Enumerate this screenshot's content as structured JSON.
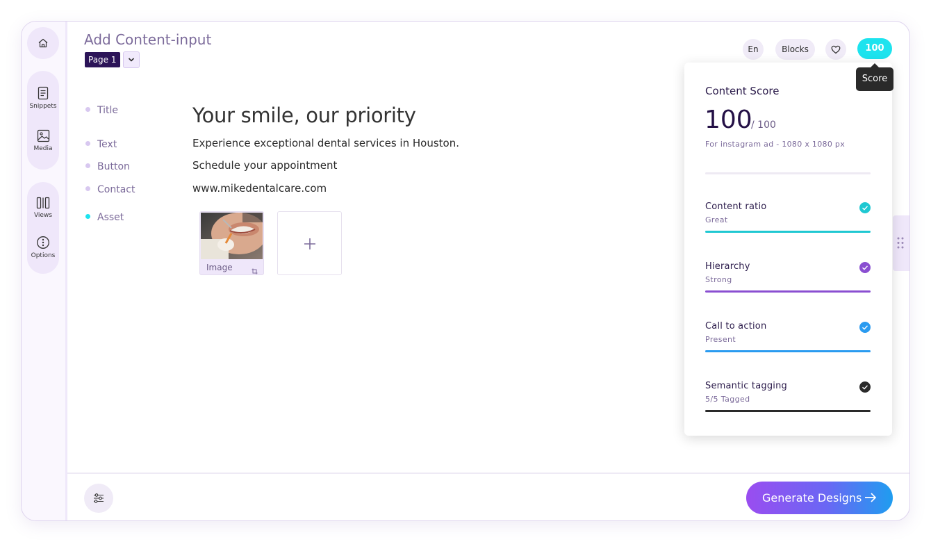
{
  "header": {
    "title": "Add Content-input",
    "page_chip": "Page 1"
  },
  "sidebar": {
    "items": [
      {
        "icon": "home-icon",
        "label": ""
      },
      {
        "icon": "document-icon",
        "label": "Snippets"
      },
      {
        "icon": "image-icon",
        "label": "Media"
      },
      {
        "icon": "columns-icon",
        "label": "Views"
      },
      {
        "icon": "options-icon",
        "label": "Options"
      }
    ]
  },
  "toolbar": {
    "language": "En",
    "blocks": "Blocks",
    "score": "100",
    "score_tooltip": "Score"
  },
  "fields": [
    {
      "label": "Title",
      "value": "Your smile, our priority"
    },
    {
      "label": "Text",
      "value": "Experience exceptional dental services in Houston."
    },
    {
      "label": "Button",
      "value": "Schedule your appointment"
    },
    {
      "label": "Contact",
      "value": "www.mikedentalcare.com"
    },
    {
      "label": "Asset",
      "value": ""
    }
  ],
  "asset": {
    "caption": "Image"
  },
  "score_panel": {
    "heading": "Content Score",
    "value": "100",
    "max": "/ 100",
    "note": "For instagram ad - 1080 x 1080 px",
    "metrics": [
      {
        "name": "Content ratio",
        "status": "Great",
        "color": "#1fc8d2"
      },
      {
        "name": "Hierarchy",
        "status": "Strong",
        "color": "#8a4fd1"
      },
      {
        "name": "Call to action",
        "status": "Present",
        "color": "#2a9bf0"
      },
      {
        "name": "Semantic tagging",
        "status": "5/5 Tagged",
        "color": "#2a2a2a"
      }
    ]
  },
  "footer": {
    "generate_label": "Generate Designs"
  }
}
